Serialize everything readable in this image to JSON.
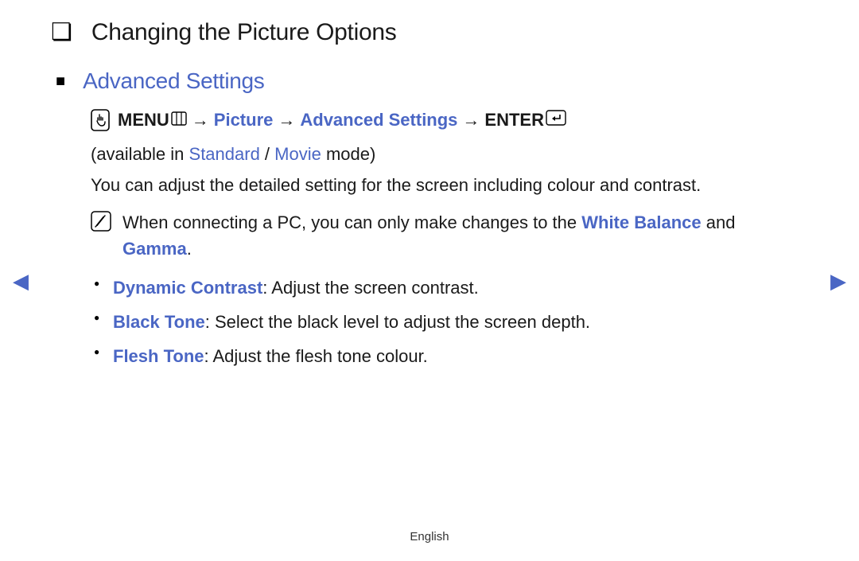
{
  "title": "Changing the Picture Options",
  "section": {
    "heading": "Advanced Settings",
    "nav": {
      "menu_label": "MENU",
      "path1": "Picture",
      "path2": "Advanced Settings",
      "enter_label": "ENTER",
      "arrow": "→"
    },
    "modes": {
      "prefix": "(available in ",
      "m1": "Standard",
      "sep": " / ",
      "m2": "Movie",
      "suffix": " mode)"
    },
    "description": "You can adjust the detailed setting for the screen including colour and contrast.",
    "note": {
      "t1": "When connecting a PC, you can only make changes to the ",
      "white_balance": "White Balance",
      "t2": " and ",
      "gamma": "Gamma",
      "t3": "."
    },
    "items": [
      {
        "name": "Dynamic Contrast",
        "desc": ": Adjust the screen contrast."
      },
      {
        "name": "Black Tone",
        "desc": ": Select the black level to adjust the screen depth."
      },
      {
        "name": "Flesh Tone",
        "desc": ": Adjust the flesh tone colour."
      }
    ]
  },
  "footer": {
    "language": "English"
  },
  "nav_arrows": {
    "left": "◀",
    "right": "▶"
  }
}
